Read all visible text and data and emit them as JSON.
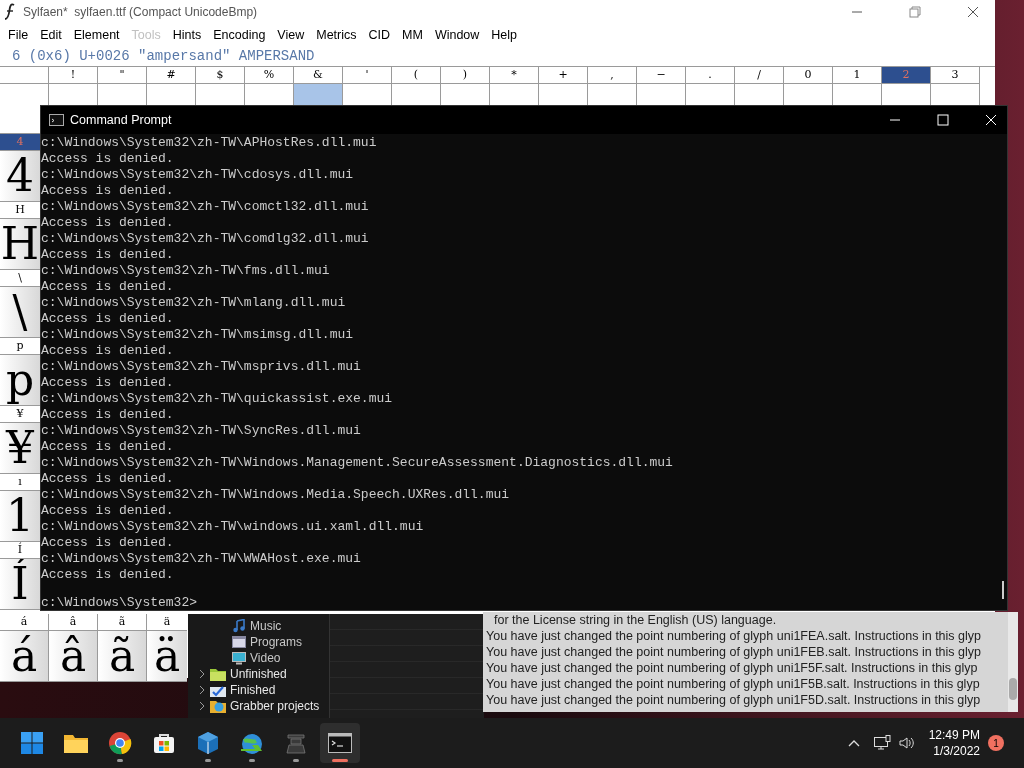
{
  "fontforge": {
    "title": "Sylfaen*  sylfaen.ttf (Compact UnicodeBmp)",
    "menu": [
      {
        "label": "File",
        "disabled": false
      },
      {
        "label": "Edit",
        "disabled": false
      },
      {
        "label": "Element",
        "disabled": false
      },
      {
        "label": "Tools",
        "disabled": true
      },
      {
        "label": "Hints",
        "disabled": false
      },
      {
        "label": "Encoding",
        "disabled": false
      },
      {
        "label": "View",
        "disabled": false
      },
      {
        "label": "Metrics",
        "disabled": false
      },
      {
        "label": "CID",
        "disabled": false
      },
      {
        "label": "MM",
        "disabled": false
      },
      {
        "label": "Window",
        "disabled": false
      },
      {
        "label": "Help",
        "disabled": false
      }
    ],
    "info": "6 (0x6) U+0026 \"ampersand\" AMPERSAND",
    "top_row": [
      {
        "selected": false,
        "current": false
      },
      {
        "header": "!",
        "selected": false,
        "current": false
      },
      {
        "header": "\"",
        "selected": false,
        "current": false
      },
      {
        "header": "#",
        "selected": false,
        "current": false
      },
      {
        "header": "$",
        "selected": false,
        "current": false
      },
      {
        "header": "%",
        "selected": false,
        "current": false
      },
      {
        "header": "&",
        "selected": false,
        "current": true
      },
      {
        "header": "'",
        "selected": false,
        "current": false
      },
      {
        "header": "(",
        "selected": false,
        "current": false
      },
      {
        "header": ")",
        "selected": false,
        "current": false
      },
      {
        "header": "*",
        "selected": false,
        "current": false
      },
      {
        "header": "+",
        "selected": false,
        "current": false
      },
      {
        "header": ",",
        "selected": false,
        "current": false
      },
      {
        "header": "−",
        "selected": false,
        "current": false
      },
      {
        "header": ".",
        "selected": false,
        "current": false
      },
      {
        "header": "/",
        "selected": false,
        "current": false
      },
      {
        "header": "0",
        "selected": false,
        "current": false
      },
      {
        "header": "1",
        "selected": false,
        "current": false
      },
      {
        "header": "2",
        "selected": true,
        "current": false
      },
      {
        "header": "3",
        "selected": false,
        "current": false
      }
    ],
    "left_column": [
      {
        "header": "4",
        "glyph": "4",
        "selected": true
      },
      {
        "header": "H",
        "glyph": "H",
        "selected": false
      },
      {
        "header": "\\",
        "glyph": "\\",
        "selected": false
      },
      {
        "header": "p",
        "glyph": "p",
        "selected": false
      },
      {
        "header": "¥",
        "glyph": "¥",
        "selected": false
      },
      {
        "header": "ı",
        "glyph": "1",
        "selected": false
      },
      {
        "header": "Í",
        "glyph": "Í",
        "selected": false
      }
    ],
    "bottom_row": [
      {
        "header": "á",
        "glyph": "á",
        "selected": false
      },
      {
        "header": "â",
        "glyph": "â",
        "selected": false
      },
      {
        "header": "ã",
        "glyph": "ã",
        "selected": false
      },
      {
        "header": "ä",
        "glyph": "ä",
        "selected": false
      }
    ]
  },
  "cmd": {
    "title": "Command Prompt",
    "lines": [
      "c:\\Windows\\System32\\zh-TW\\APHostRes.dll.mui",
      "Access is denied.",
      "c:\\Windows\\System32\\zh-TW\\cdosys.dll.mui",
      "Access is denied.",
      "c:\\Windows\\System32\\zh-TW\\comctl32.dll.mui",
      "Access is denied.",
      "c:\\Windows\\System32\\zh-TW\\comdlg32.dll.mui",
      "Access is denied.",
      "c:\\Windows\\System32\\zh-TW\\fms.dll.mui",
      "Access is denied.",
      "c:\\Windows\\System32\\zh-TW\\mlang.dll.mui",
      "Access is denied.",
      "c:\\Windows\\System32\\zh-TW\\msimsg.dll.mui",
      "Access is denied.",
      "c:\\Windows\\System32\\zh-TW\\msprivs.dll.mui",
      "Access is denied.",
      "c:\\Windows\\System32\\zh-TW\\quickassist.exe.mui",
      "Access is denied.",
      "c:\\Windows\\System32\\zh-TW\\SyncRes.dll.mui",
      "Access is denied.",
      "c:\\Windows\\System32\\zh-TW\\Windows.Management.SecureAssessment.Diagnostics.dll.mui",
      "Access is denied.",
      "c:\\Windows\\System32\\zh-TW\\Windows.Media.Speech.UXRes.dll.mui",
      "Access is denied.",
      "c:\\Windows\\System32\\zh-TW\\windows.ui.xaml.dll.mui",
      "Access is denied.",
      "c:\\Windows\\System32\\zh-TW\\WWAHost.exe.mui",
      "Access is denied."
    ],
    "prompt": "c:\\Windows\\System32>"
  },
  "explorer": {
    "partial_children": [
      {
        "label": "Music",
        "kind": "music"
      },
      {
        "label": "Programs",
        "kind": "programs"
      },
      {
        "label": "Video",
        "kind": "video"
      }
    ],
    "items": [
      {
        "label": "Unfinished",
        "kind": "unfinished"
      },
      {
        "label": "Finished",
        "kind": "finished"
      },
      {
        "label": "Grabber projects",
        "kind": "grabber"
      }
    ]
  },
  "log": {
    "lines": [
      "for the License string in the English (US) language.",
      "You have just changed the point numbering of glyph uni1FEA.salt. Instructions in this glyp",
      "You have just changed the point numbering of glyph uni1FEB.salt. Instructions in this glyp",
      "You have just changed the point numbering of glyph uni1F5F.salt. Instructions in this glyp",
      "You have just changed the point numbering of glyph uni1F5B.salt. Instructions in this glyp",
      "You have just changed the point numbering of glyph uni1F5D.salt. Instructions in this glyp"
    ]
  },
  "taskbar": {
    "apps": [
      {
        "kind": "start",
        "running": false,
        "active": false
      },
      {
        "kind": "folder",
        "running": false,
        "active": false
      },
      {
        "kind": "browser",
        "running": true,
        "active": false
      },
      {
        "kind": "store",
        "running": false,
        "active": false
      },
      {
        "kind": "cube",
        "running": true,
        "active": false
      },
      {
        "kind": "globe",
        "running": true,
        "active": false
      },
      {
        "kind": "fontforge",
        "running": true,
        "active": false
      },
      {
        "kind": "terminal",
        "running": true,
        "active": true
      }
    ],
    "time": "12:49 PM",
    "date": "1/3/2022",
    "badge": "1"
  }
}
